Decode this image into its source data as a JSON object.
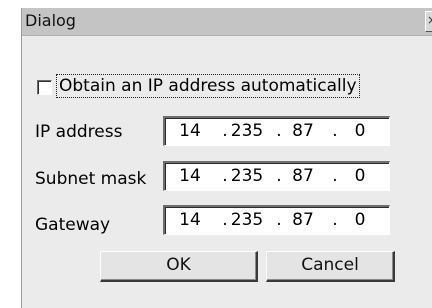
{
  "window": {
    "title": "Dialog",
    "close_glyph": "×"
  },
  "auto_ip": {
    "label": "Obtain an IP address automatically",
    "checked": false
  },
  "fields": {
    "ip_address": {
      "label": "IP address",
      "octets": [
        "14",
        "235",
        "87",
        "0"
      ]
    },
    "subnet_mask": {
      "label": "Subnet mask",
      "octets": [
        "14",
        "235",
        "87",
        "0"
      ]
    },
    "gateway": {
      "label": "Gateway",
      "octets": [
        "14",
        "235",
        "87",
        "0"
      ]
    }
  },
  "separator": ".",
  "buttons": {
    "ok_label": "OK",
    "cancel_label": "Cancel"
  }
}
